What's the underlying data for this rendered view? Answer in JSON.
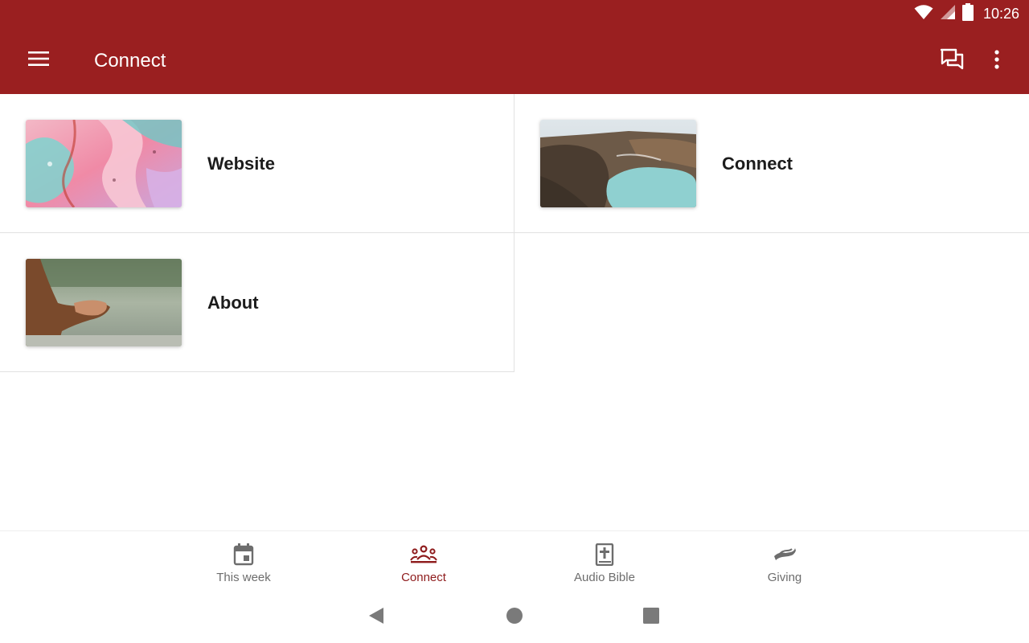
{
  "status_bar": {
    "time": "10:26",
    "icons": [
      "wifi-icon",
      "signal-icon",
      "battery-icon"
    ]
  },
  "app_bar": {
    "title": "Connect",
    "icons": [
      "menu-icon",
      "chat-icon",
      "more-vert-icon"
    ]
  },
  "cards": [
    {
      "label": "Website",
      "image": "abstract pink and teal fluid art"
    },
    {
      "label": "Connect",
      "image": "volcanic crater lake landscape"
    },
    {
      "label": "About",
      "image": "person with folded hands by a lake"
    }
  ],
  "bottom_nav": {
    "items": [
      {
        "label": "This week",
        "icon": "calendar-icon",
        "active": false
      },
      {
        "label": "Connect",
        "icon": "people-icon",
        "active": true
      },
      {
        "label": "Audio Bible",
        "icon": "bible-icon",
        "active": false
      },
      {
        "label": "Giving",
        "icon": "giving-hand-icon",
        "active": false
      }
    ]
  },
  "colors": {
    "primary": "#9a1f20",
    "active_nav": "#8e1b1c",
    "inactive_nav": "#6d6d6d",
    "divider": "#e2e2e2"
  },
  "system_nav": [
    "back-icon",
    "home-icon",
    "recents-icon"
  ]
}
